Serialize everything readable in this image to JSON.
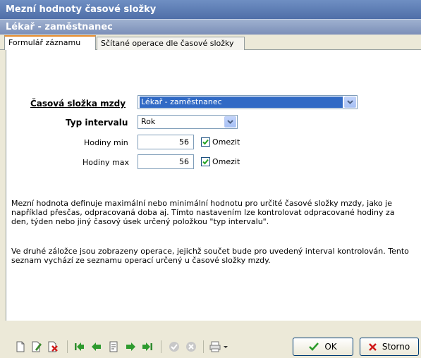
{
  "window": {
    "title": "Mezní hodnoty časové složky",
    "subtitle": "Lékař - zaměstnanec"
  },
  "tabs": [
    {
      "label": "Formulář záznamu",
      "active": true
    },
    {
      "label": "Sčítané operace dle časové složky",
      "active": false
    }
  ],
  "form": {
    "casova_slozka": {
      "label": "Časová složka mzdy",
      "value": "Lékař - zaměstnanec"
    },
    "typ_intervalu": {
      "label": "Typ intervalu",
      "value": "Rok"
    },
    "hodiny_min": {
      "label": "Hodiny min",
      "value": "56",
      "check_label": "Omezit",
      "checked": true
    },
    "hodiny_max": {
      "label": "Hodiny max",
      "value": "56",
      "check_label": "Omezit",
      "checked": true
    }
  },
  "description": {
    "p1": "Mezní hodnota definuje maximální nebo minimální hodnotu pro určité časové složky mzdy, jako je například přesčas, odpracovaná doba aj. Tímto nastavením lze kontrolovat odpracované hodiny za den, týden nebo jiný časový úsek určený položkou \"typ intervalu\".",
    "p2": "Ve druhé záložce jsou zobrazeny operace, jejichž součet bude pro uvedený interval kontrolován. Tento seznam vychází ze seznamu operací určený u časové složky mzdy."
  },
  "toolbar": {
    "icons": [
      "new-record-icon",
      "edit-record-icon",
      "delete-record-icon",
      "first-record-icon",
      "previous-record-icon",
      "record-list-icon",
      "next-record-icon",
      "last-record-icon",
      "confirm-disabled-icon",
      "cancel-disabled-icon",
      "print-icon"
    ],
    "ok_label": "OK",
    "storno_label": "Storno"
  },
  "colors": {
    "title_bar": "#5b7bb4",
    "tab_highlight": "#e68b2c",
    "selection": "#316ac5",
    "ok_check": "#2a9a2a",
    "storno_x": "#d01818"
  }
}
